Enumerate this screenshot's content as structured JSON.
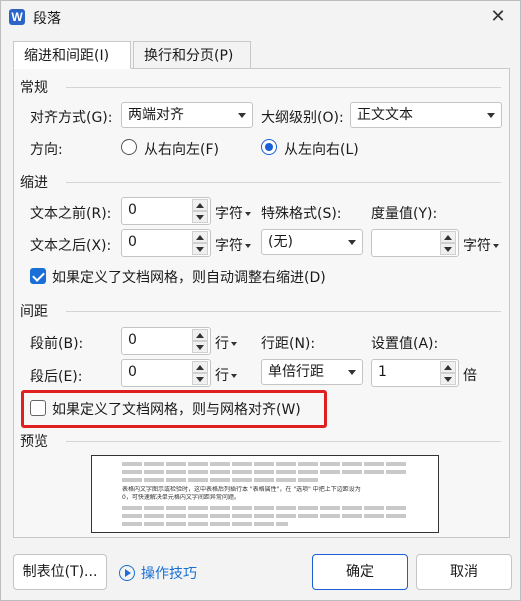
{
  "window": {
    "icon_letter": "W",
    "title": "段落",
    "close": "✕"
  },
  "tabs": [
    {
      "label": "缩进和间距(I)"
    },
    {
      "label": "换行和分页(P)"
    }
  ],
  "general": {
    "title": "常规",
    "align_label": "对齐方式(G):",
    "align_value": "两端对齐",
    "outline_label": "大纲级别(O):",
    "outline_value": "正文文本",
    "direction_label": "方向:",
    "rtl_label": "从右向左(F)",
    "ltr_label": "从左向右(L)"
  },
  "indent": {
    "title": "缩进",
    "before_label": "文本之前(R):",
    "before_value": "0",
    "before_unit": "字符",
    "after_label": "文本之后(X):",
    "after_value": "0",
    "after_unit": "字符",
    "special_label": "特殊格式(S):",
    "special_value": "(无)",
    "measure_label": "度量值(Y):",
    "measure_value": "",
    "measure_unit": "字符",
    "auto_adjust_label": "如果定义了文档网格，则自动调整右缩进(D)"
  },
  "spacing": {
    "title": "间距",
    "before_label": "段前(B):",
    "before_value": "0",
    "before_unit": "行",
    "after_label": "段后(E):",
    "after_value": "0",
    "after_unit": "行",
    "line_label": "行距(N):",
    "line_value": "单倍行距",
    "setting_label": "设置值(A):",
    "setting_value": "1",
    "setting_unit": "倍",
    "snap_grid_label": "如果定义了文档网格，则与网格对齐(W)"
  },
  "preview": {
    "title": "预览",
    "sample_line_1": "表格内文字图示或检验时，这中表格后列插行本 \"表格属性\"，在 \"选项\" 中把上下边距设为",
    "sample_line_2": "0，可快速解决单元格内文字间距异常问题。"
  },
  "footer": {
    "tabs_button": "制表位(T)...",
    "tips_link": "操作技巧",
    "ok_button": "确定",
    "cancel_button": "取消"
  }
}
